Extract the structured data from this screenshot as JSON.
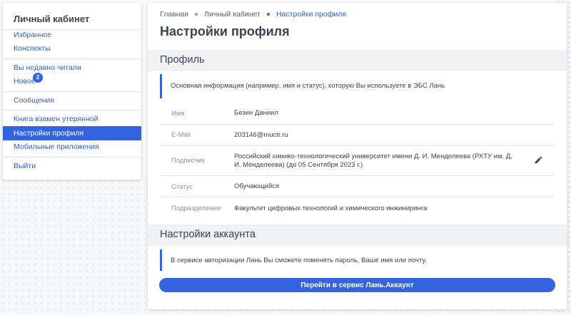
{
  "sidebar": {
    "title": "Личный кабинет",
    "items": [
      {
        "label": "Избранное"
      },
      {
        "label": "Конспекты"
      },
      {
        "label": "Вы недавно читали"
      },
      {
        "label": "Новое",
        "badge": "2"
      },
      {
        "label": "Сообщения"
      },
      {
        "label": "Книга взамен утерянной"
      },
      {
        "label": "Настройки профиля",
        "active": true
      },
      {
        "label": "Мобильные приложения"
      },
      {
        "label": "Выйти"
      }
    ]
  },
  "breadcrumb": [
    "Главная",
    "Личный кабинет",
    "Настройки профиля"
  ],
  "page_title": "Настройки профиля",
  "profile": {
    "header": "Профиль",
    "info": "Основная информация (например, имя и статус), которую Вы используете в ЭБС Лань",
    "rows": [
      {
        "label": "Имя",
        "value": "Безин Даниил"
      },
      {
        "label": "E-Mail",
        "value": "203146@muctr.ru"
      },
      {
        "label": "Подписчик",
        "value": "Российский химико-технологический университет имени Д. И. Менделеева (РХТУ им. Д. И. Менделеева) (до 05 Сентября 2023 г.)"
      },
      {
        "label": "Статус",
        "value": "Обучающийся"
      },
      {
        "label": "Подразделение",
        "value": "Факультет цифровых технологий и химического инжиниринга"
      }
    ]
  },
  "account": {
    "header": "Настройки аккаунта",
    "info": "В сервисе авторизации Лань Вы сможете поменять пароль, Ваше имя или почту.",
    "button_label": "Перейти в сервис Лань.Аккаунт"
  },
  "colors": {
    "accent": "#3463e0",
    "link": "#2f5fc4"
  },
  "icons": {
    "edit": "pencil-icon"
  }
}
